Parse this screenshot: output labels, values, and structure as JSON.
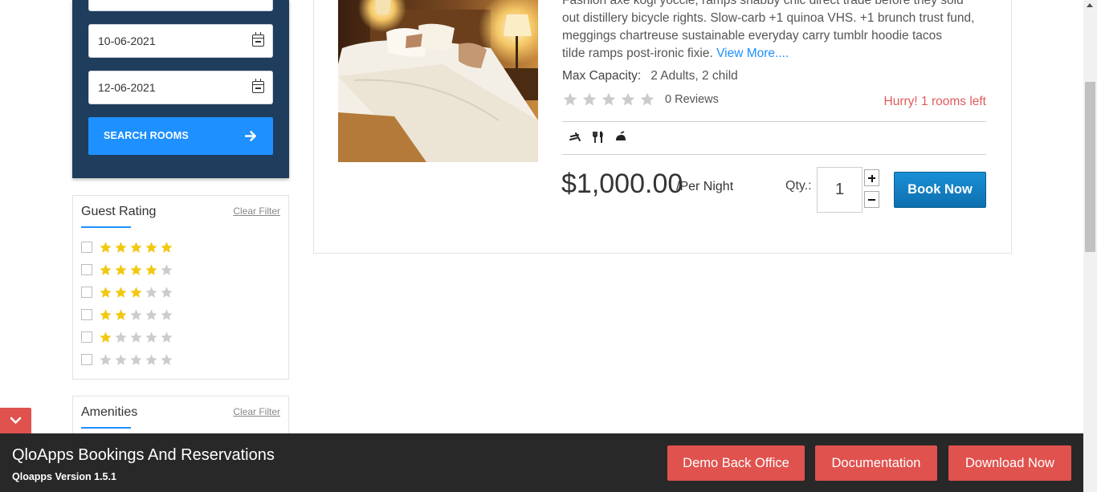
{
  "booking": {
    "check_in": "10-06-2021",
    "check_out": "12-06-2021",
    "search_label": "SEARCH ROOMS"
  },
  "guest_rating": {
    "title": "Guest Rating",
    "clear_label": "Clear Filter",
    "options": [
      {
        "stars": 5
      },
      {
        "stars": 4
      },
      {
        "stars": 3
      },
      {
        "stars": 2
      },
      {
        "stars": 1
      },
      {
        "stars": 0
      }
    ]
  },
  "amenities": {
    "title": "Amenities",
    "clear_label": "Clear Filter"
  },
  "room": {
    "description_line1": "Fashion axe kogi yoccie, ramps shabby chic direct trade before they sold",
    "description_line2": "out distillery bicycle rights. Slow-carb +1 quinoa VHS. +1 brunch trust fund,",
    "description_line3": "meggings chartreuse sustainable everyday carry tumblr hoodie tacos",
    "description_line4": "tilde ramps post-ironic fixie.",
    "view_more": "View More....",
    "capacity_label": "Max Capacity:",
    "capacity_value": "2 Adults, 2 child",
    "rating": 0,
    "reviews": "0 Reviews",
    "availability": "Hurry! 1 rooms left",
    "amenity_icons": [
      "wifi-icon",
      "restaurant-icon",
      "room-service-icon"
    ],
    "price": "$1,000.00",
    "price_unit": "/Per Night",
    "qty_label": "Qty.:",
    "qty_value": "1",
    "book_label": "Book Now"
  },
  "demo_bar": {
    "title": "QloApps Bookings And Reservations",
    "version": "Qloapps Version 1.5.1",
    "buttons": [
      "Demo Back Office",
      "Documentation",
      "Download Now"
    ]
  },
  "colors": {
    "panel": "#1f3d5c",
    "primary": "#1e90ff",
    "star_on": "#f2c811",
    "star_off": "#cccccc",
    "alert": "#e05a5a",
    "bar_bg": "#282828",
    "bar_btn": "#e0524e"
  }
}
